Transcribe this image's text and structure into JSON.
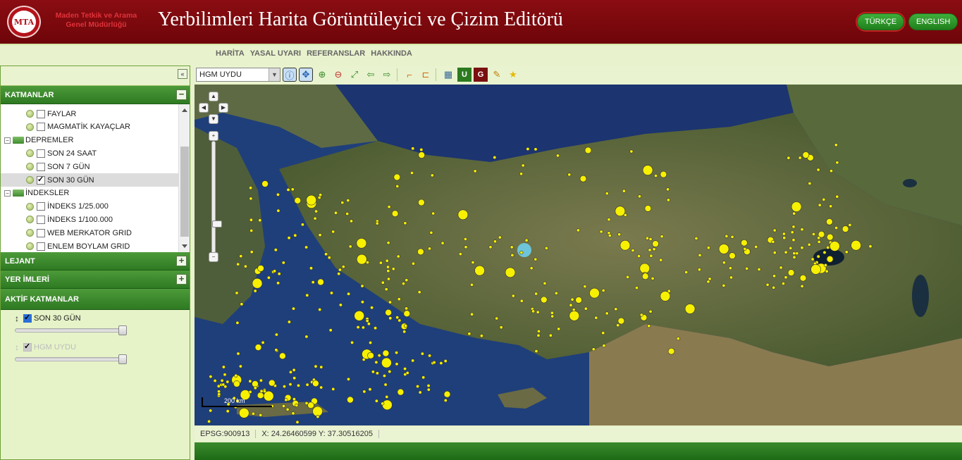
{
  "header": {
    "logo_text": "MTA",
    "org_line1": "Maden Tetkik ve Arama",
    "org_line2": "Genel Müdürlüğü",
    "title": "Yerbilimleri Harita Görüntüleyici ve Çizim Editörü",
    "lang_tr": "TÜRKÇE",
    "lang_en": "ENGLISH"
  },
  "nav": [
    "HARİTA",
    "YASAL UYARI",
    "REFERANSLAR",
    "HAKKINDA"
  ],
  "panel": {
    "collapse_icon": "«",
    "layers_title": "KATMANLAR",
    "layers": [
      {
        "label": "FAYLAR",
        "type": "item",
        "checked": false
      },
      {
        "label": "MAGMATİK KAYAÇLAR",
        "type": "item",
        "checked": false
      },
      {
        "label": "DEPREMLER",
        "type": "group"
      },
      {
        "label": "SON 24 SAAT",
        "type": "item",
        "checked": false
      },
      {
        "label": "SON 7 GÜN",
        "type": "item",
        "checked": false
      },
      {
        "label": "SON 30 GÜN",
        "type": "item",
        "checked": true
      },
      {
        "label": "İNDEKSLER",
        "type": "group"
      },
      {
        "label": "İNDEKS 1/25.000",
        "type": "item",
        "checked": false
      },
      {
        "label": "İNDEKS 1/100.000",
        "type": "item",
        "checked": false
      },
      {
        "label": "WEB MERKATOR GRID",
        "type": "item",
        "checked": false
      },
      {
        "label": "ENLEM BOYLAM GRID",
        "type": "item",
        "checked": false
      }
    ],
    "legend_title": "LEJANT",
    "bookmarks_title": "YER İMLERİ",
    "active_title": "AKTİF KATMANLAR",
    "active_layers": [
      {
        "label": "SON 30 GÜN",
        "checked": true,
        "opacity": 1.0
      },
      {
        "label": "HGM UYDU",
        "checked": true,
        "opacity": 1.0,
        "disabled": true
      }
    ]
  },
  "toolbar": {
    "base_layer": "HGM UYDU",
    "tools": [
      "info-icon",
      "pan-icon",
      "zoom-in-icon",
      "zoom-out-icon",
      "full-extent-icon",
      "back-icon",
      "forward-icon",
      "measure-line-icon",
      "measure-area-icon",
      "image-icon",
      "u-icon",
      "g-icon",
      "edit-icon",
      "star-icon"
    ]
  },
  "map": {
    "scale_label": "200 km"
  },
  "status": {
    "projection": "EPSG:900913",
    "coords": "X: 24.26460599 Y: 37.30516205"
  },
  "colors": {
    "header_bg": "#7a0a0e",
    "panel_green": "#3a8a2c",
    "quake_yellow": "#f7f000"
  }
}
